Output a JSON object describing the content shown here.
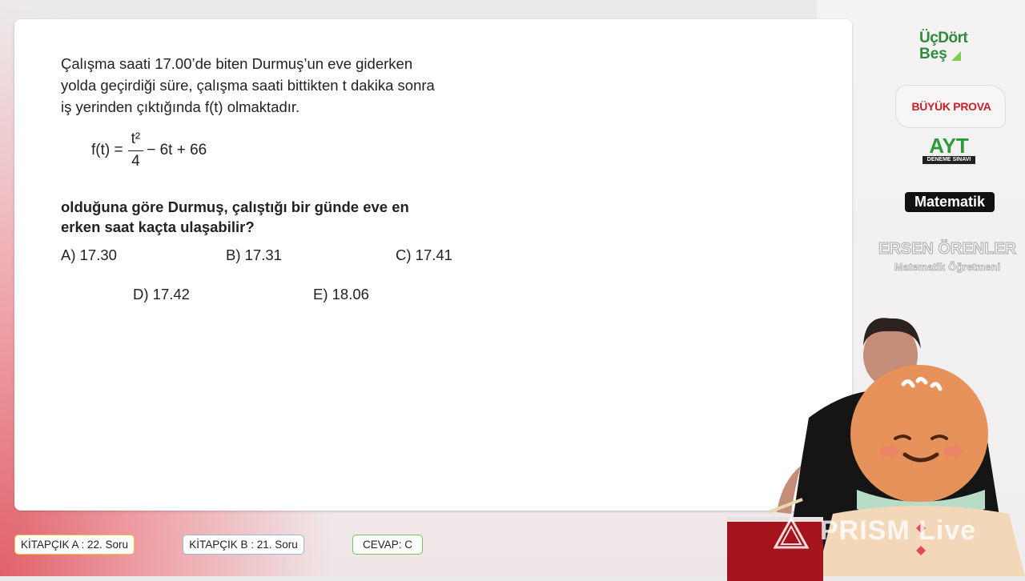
{
  "question": {
    "lines": [
      "Çalışma saati 17.00’de biten Durmuş’un eve giderken",
      "yolda geçirdiği süre, çalışma saati bittikten t dakika sonra",
      "iş yerinden çıktığında f(t) olmaktadır."
    ],
    "formula": {
      "lhs": "f(t) =",
      "numerator": "t²",
      "denominator": "4",
      "rest": "− 6t + 66"
    },
    "prompt_lines": [
      "olduğuna göre Durmuş, çalıştığı bir günde eve en",
      "erken saat kaçta ulaşabilir?"
    ],
    "options": {
      "a": "A) 17.30",
      "b": "B) 17.31",
      "c": "C) 17.41",
      "d": "D) 17.42",
      "e": "E) 18.06"
    }
  },
  "sidebar": {
    "brand_line1": "ÜçDört",
    "brand_line2": "Beş",
    "prova": "BÜYÜK PROVA",
    "exam": "AYT",
    "exam_sub": "DENEME SINAVI",
    "subject": "Matematik",
    "teacher_name": "ERSEN ÖRENLER",
    "teacher_title": "Matematik Öğretmeni"
  },
  "footer": {
    "kitapcik_a": "KİTAPÇIK A : 22. Soru",
    "kitapcik_b": "KİTAPÇIK B : 21. Soru",
    "cevap": "CEVAP: C"
  },
  "overlay": {
    "prism_label": "PRISM Live"
  }
}
